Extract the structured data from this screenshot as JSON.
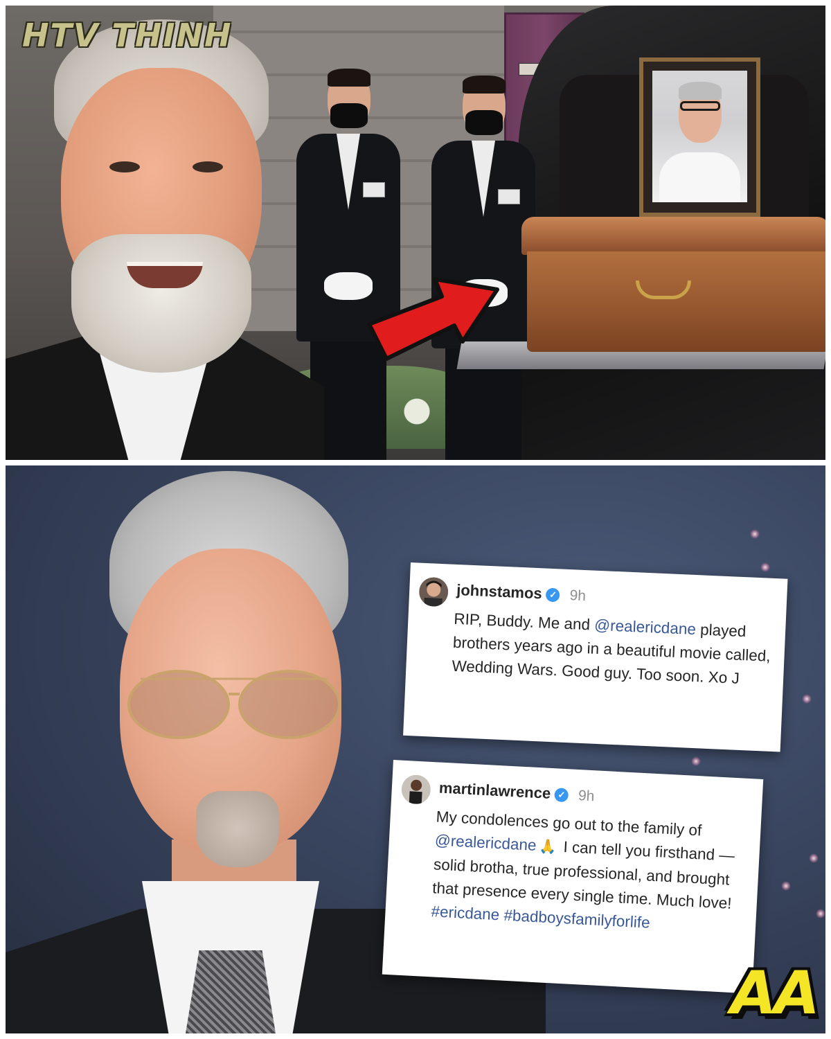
{
  "top_panel": {
    "watermark": "HTV THINH",
    "arrow_color": "#e01c1c",
    "portrait_caption": ""
  },
  "bottom_panel": {
    "posts": [
      {
        "username": "johnstamos",
        "verified": true,
        "time": "9h",
        "segments": [
          {
            "text": "RIP, Buddy.  Me and ",
            "kind": "text"
          },
          {
            "text": "@realericdane",
            "kind": "mention"
          },
          {
            "text": " played brothers years ago in a beautiful movie called, Wedding Wars.  Good guy.  Too soon. Xo J",
            "kind": "text"
          }
        ]
      },
      {
        "username": "martinlawrence",
        "verified": true,
        "time": "9h",
        "segments": [
          {
            "text": "My condolences go out to the family of ",
            "kind": "text"
          },
          {
            "text": "@realericdane",
            "kind": "mention"
          },
          {
            "text": "pray-icon",
            "kind": "icon"
          },
          {
            "text": " I can tell you firsthand — solid brotha, true professional, and brought that presence every single time. Much love! ",
            "kind": "text"
          },
          {
            "text": "#ericdane",
            "kind": "hashtag"
          },
          {
            "text": " ",
            "kind": "text"
          },
          {
            "text": "#badboysfamilyforlife",
            "kind": "hashtag"
          }
        ]
      }
    ],
    "logo": "AA"
  },
  "colors": {
    "link": "#385898",
    "verified": "#3897f0",
    "logo_yellow": "#f4e526",
    "watermark": "#c7c18b"
  }
}
